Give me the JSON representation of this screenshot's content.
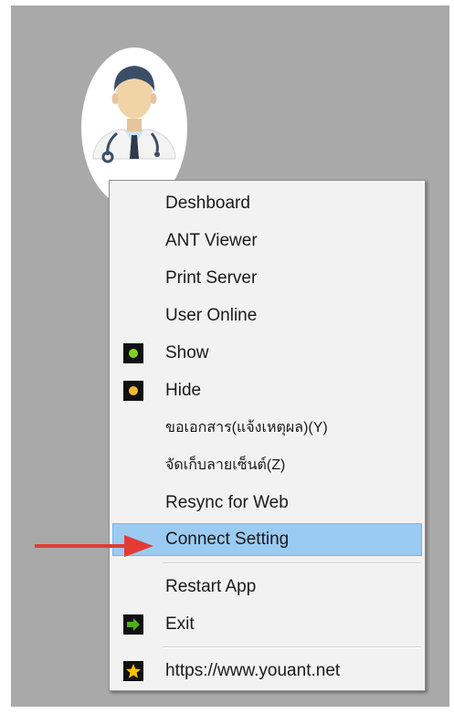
{
  "menu": {
    "items": [
      {
        "label": "Deshboard"
      },
      {
        "label": "ANT Viewer"
      },
      {
        "label": "Print Server"
      },
      {
        "label": "User Online"
      },
      {
        "label": "Show",
        "icon": "green-dot-icon"
      },
      {
        "label": "Hide",
        "icon": "orange-dot-icon"
      },
      {
        "label": "ขอเอกสาร(แจ้งเหตุผล)(Y)"
      },
      {
        "label": "จัดเก็บลายเซ็นต์(Z)"
      },
      {
        "label": "Resync for Web"
      },
      {
        "label": "Connect Setting",
        "highlighted": true
      },
      {
        "label": "Restart App"
      },
      {
        "label": "Exit",
        "icon": "green-arrow-icon"
      },
      {
        "label": "https://www.youant.net",
        "icon": "star-icon"
      }
    ]
  },
  "colors": {
    "desktop": "#a9a9a9",
    "menu_bg": "#f2f2f2",
    "highlight": "#9ccbf1",
    "arrow": "#e53935",
    "show_dot": "#7ed321",
    "hide_dot": "#f5b833",
    "exit_arrow": "#4caf1a",
    "star": "#ffc107"
  }
}
